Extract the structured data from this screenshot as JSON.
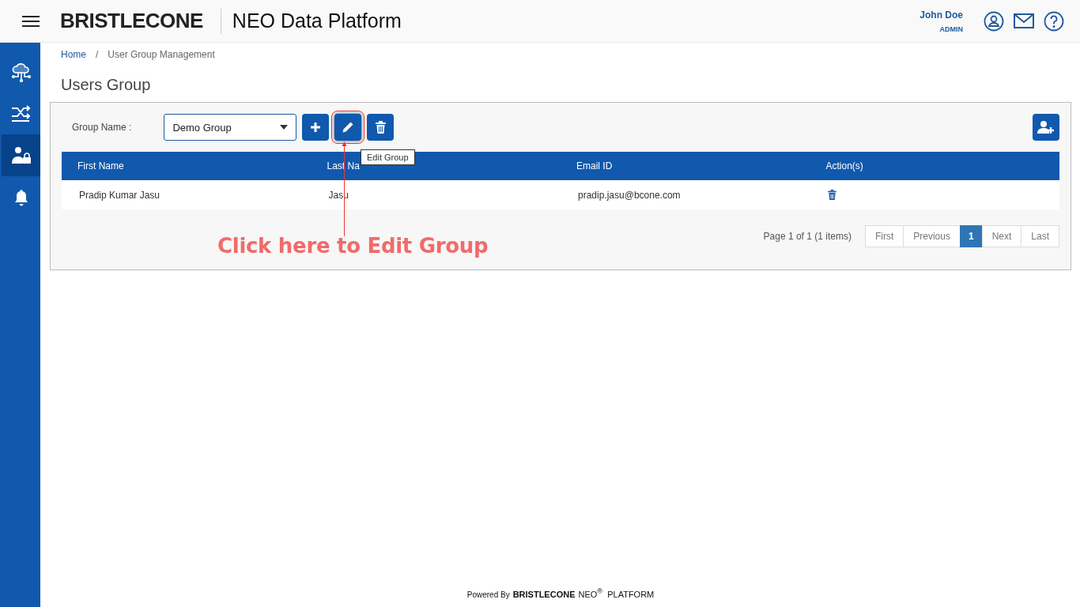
{
  "header": {
    "brand": "BRISTLECONE",
    "title": "NEO Data Platform",
    "user_name": "John Doe",
    "user_role": "ADMIN"
  },
  "sidebar": {
    "items": [
      {
        "kind": "cloud",
        "selected": false
      },
      {
        "kind": "shuffle",
        "selected": false
      },
      {
        "kind": "user-lock",
        "selected": true
      },
      {
        "kind": "bell",
        "selected": false
      }
    ]
  },
  "breadcrumb": [
    "Home",
    "/",
    "User Group Management"
  ],
  "page_title": "Users Group",
  "group_field": {
    "label": "Group Name :",
    "value": "Demo Group"
  },
  "tooltip": "Edit Group",
  "table": {
    "columns": [
      "First Name",
      "Last Na",
      "Email ID",
      "Action(s)"
    ],
    "rows": [
      {
        "first_name": "Pradip Kumar Jasu",
        "last_name": "Jasu",
        "email": "pradip.jasu@bcone.com"
      }
    ]
  },
  "pagination": {
    "summary": "Page 1 of 1 (1 items)",
    "buttons": [
      {
        "label": "First",
        "selected": false
      },
      {
        "label": "Previous",
        "selected": false
      },
      {
        "label": "1",
        "selected": true
      },
      {
        "label": "Next",
        "selected": false
      },
      {
        "label": "Last",
        "selected": false
      }
    ]
  },
  "annotation": "Click here to Edit Group",
  "footer": {
    "prefix": "Powered By",
    "brand": "BRISTLECONE",
    "product": "NEO$^{®}$  PLATFORM"
  }
}
